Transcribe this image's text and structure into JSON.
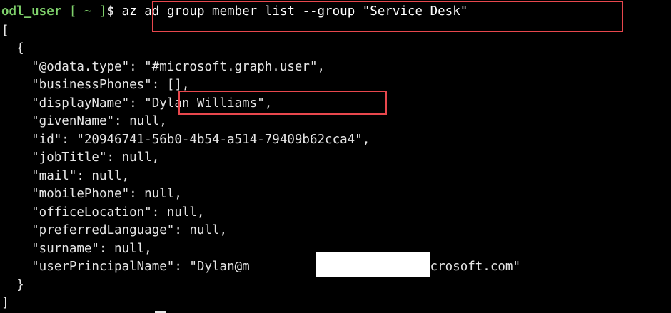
{
  "prompt": {
    "user": "odl_user",
    "path": "[ ~ ]",
    "symbol": "$"
  },
  "command": "az ad group member list --group \"Service Desk\"",
  "output": [
    "[",
    "  {",
    "    \"@odata.type\": \"#microsoft.graph.user\",",
    "    \"businessPhones\": [],",
    "    \"displayName\": \"Dylan Williams\",",
    "    \"givenName\": null,",
    "    \"id\": \"20946741-56b0-4b54-a514-79409b62cca4\",",
    "    \"jobTitle\": null,",
    "    \"mail\": null,",
    "    \"mobilePhone\": null,",
    "    \"officeLocation\": null,",
    "    \"preferredLanguage\": null,",
    "    \"surname\": null,",
    "    \"userPrincipalName\": \"Dylan@m                    onmicrosoft.com\"",
    "  }",
    "]"
  ],
  "colors": {
    "background": "#000000",
    "prompt": "#7fd16b",
    "text": "#e6e6e6",
    "highlight_box": "#e8474d",
    "redaction": "#ffffff"
  }
}
